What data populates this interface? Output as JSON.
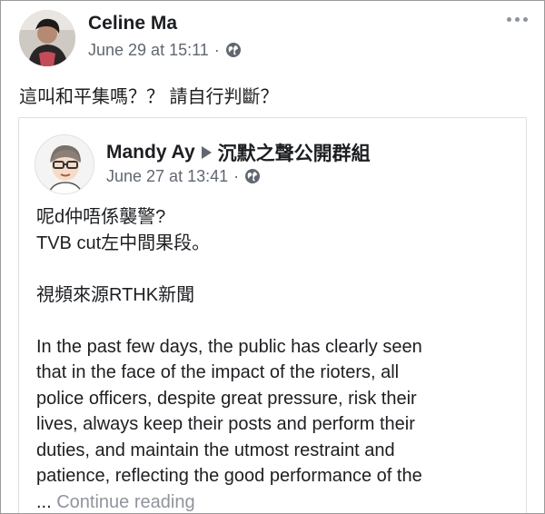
{
  "post": {
    "author": "Celine Ma",
    "timestamp": "June 29 at 15:11",
    "separator": "·",
    "privacy_icon": "globe-icon",
    "text": "這叫和平集嗎？？ 請自行判斷？",
    "more_icon": "more-options-icon"
  },
  "shared_post": {
    "author": "Mandy Ay",
    "group": "沉默之聲公開群組",
    "timestamp": "June 27 at 13:41",
    "separator": "·",
    "body": {
      "line1": "呢d仲唔係襲警?",
      "line2": "TVB cut左中間果段。",
      "line3": "視頻來源RTHK新聞",
      "para": [
        "In the past few days, the public has clearly seen",
        "that in the face of the impact of the rioters, all",
        "police officers, despite great pressure, risk their",
        "lives, always keep their posts and perform their",
        "duties, and maintain the utmost restraint and",
        "patience, reflecting the good performance of the"
      ],
      "ellipsis": "...",
      "continue": "Continue reading"
    }
  },
  "colors": {
    "text": "#1c1e21",
    "meta": "#606770",
    "continue_link": "#90949c",
    "border": "#dddfe2"
  }
}
